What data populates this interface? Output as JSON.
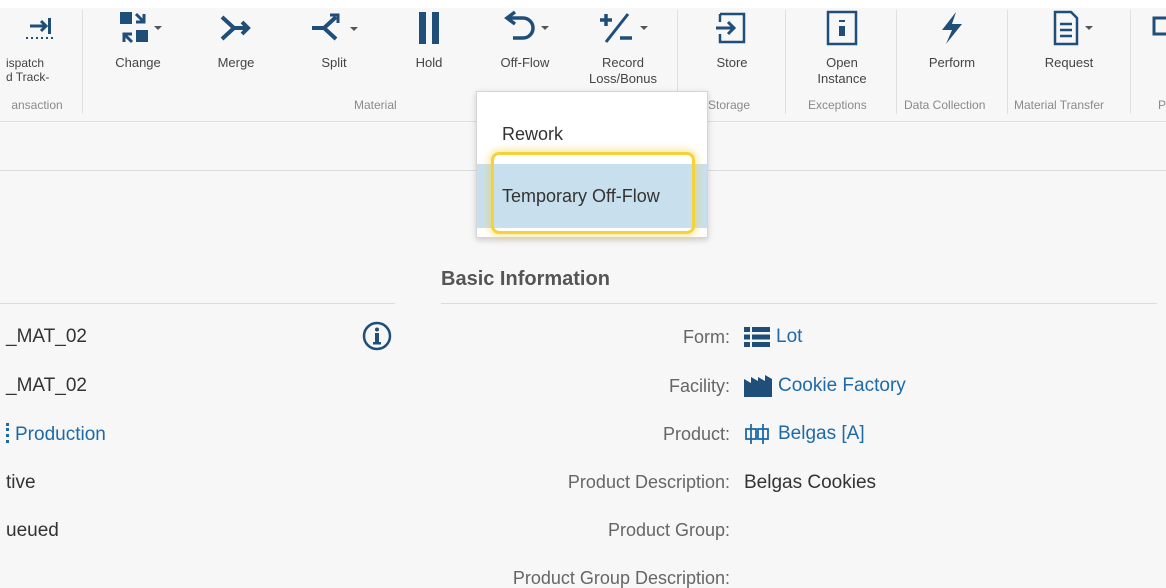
{
  "ribbon": {
    "buttons": {
      "dispatch_track": "ispatch\nd Track-",
      "change": "Change",
      "merge": "Merge",
      "split": "Split",
      "hold": "Hold",
      "off_flow": "Off-Flow",
      "record_loss_bonus": "Record\nLoss/Bonus",
      "store": "Store",
      "open_instance": "Open\nInstance",
      "perform": "Perform",
      "request": "Request"
    },
    "groups": {
      "transaction": "ansaction",
      "material": "Material",
      "storage": "Storage",
      "exceptions": "Exceptions",
      "data_collection": "Data Collection",
      "material_transfer": "Material Transfer",
      "partial": "P"
    },
    "accent_color": "#1f4e79"
  },
  "offflow_menu": {
    "items": [
      "Rework",
      "Temporary Off-Flow"
    ],
    "selected": "Temporary Off-Flow",
    "highlight_color": "#f4d23a"
  },
  "left_panel": {
    "name": "_MAT_02",
    "name2": "_MAT_02",
    "type": "Production",
    "status": "tive",
    "state": "ueued"
  },
  "basic_info": {
    "title": "Basic Information",
    "fields": {
      "form_label": "Form:",
      "form_value": "Lot",
      "facility_label": "Facility:",
      "facility_value": "Cookie Factory",
      "product_label": "Product:",
      "product_value": "Belgas [A]",
      "product_desc_label": "Product Description:",
      "product_desc_value": "Belgas Cookies",
      "product_group_label": "Product Group:",
      "product_group_desc_label": "Product Group Description:"
    }
  }
}
